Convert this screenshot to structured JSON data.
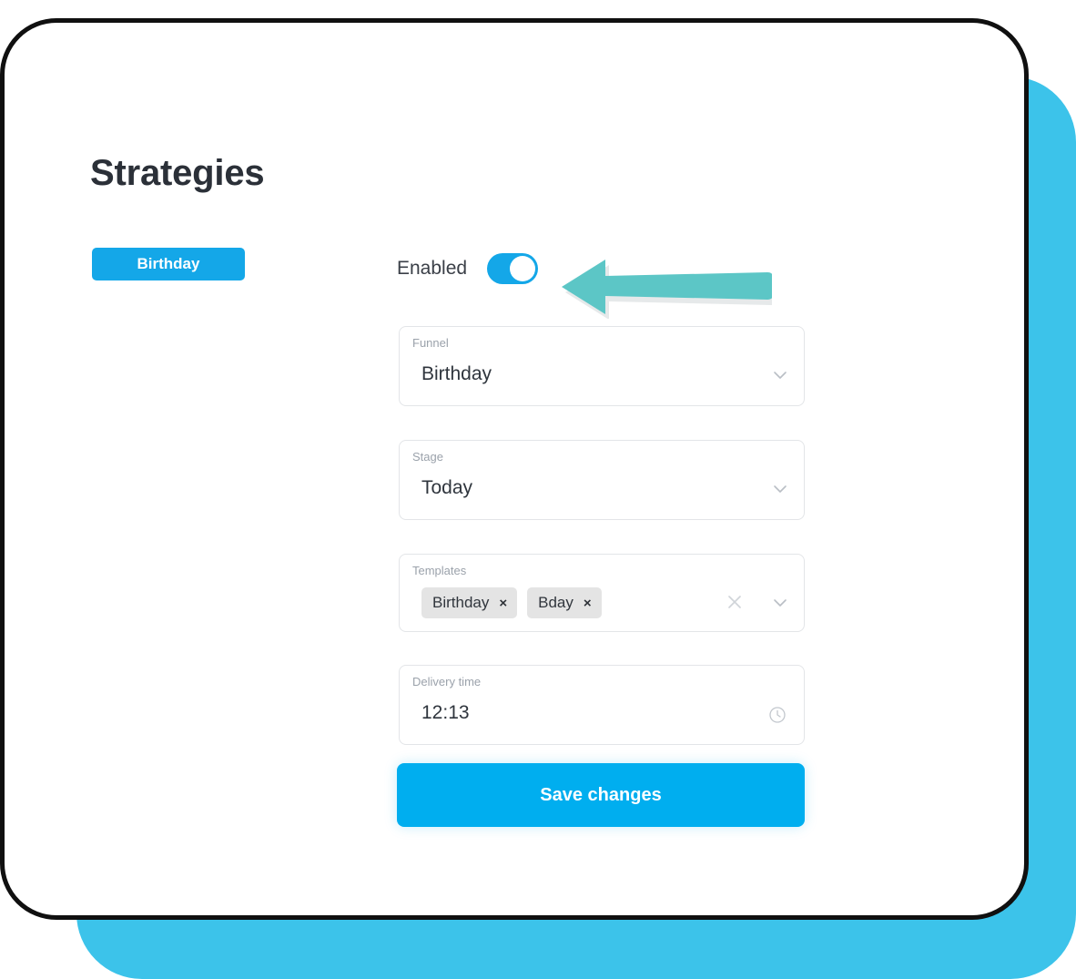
{
  "page": {
    "title": "Strategies",
    "background_blue": "#3CC3EA",
    "accent_blue": "#14A7E8",
    "arrow_color": "#5CC6C6"
  },
  "sidebar": {
    "items": [
      {
        "label": "Birthday",
        "active": true
      }
    ]
  },
  "form": {
    "enabled": {
      "label": "Enabled",
      "state": "on"
    },
    "funnel": {
      "label": "Funnel",
      "value": "Birthday",
      "icon": "chevron-down-icon"
    },
    "stage": {
      "label": "Stage",
      "value": "Today",
      "icon": "chevron-down-icon"
    },
    "templates": {
      "label": "Templates",
      "chips": [
        {
          "label": "Birthday",
          "remove": "×"
        },
        {
          "label": "Bday",
          "remove": "×"
        }
      ],
      "clear_icon": "close-icon",
      "dropdown_icon": "chevron-down-icon"
    },
    "delivery_time": {
      "label": "Delivery time",
      "value": "12:13",
      "icon": "clock-icon"
    },
    "save_label": "Save changes"
  },
  "annotation": {
    "arrow": "left-arrow-annotation"
  }
}
